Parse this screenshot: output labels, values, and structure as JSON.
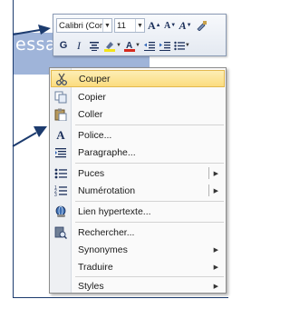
{
  "document": {
    "selected_text": "essai"
  },
  "mini_toolbar": {
    "font_name": "Calibri (Cor",
    "font_size": "11",
    "grow_font": "A",
    "shrink_font": "A",
    "styles": "A",
    "bold": "G",
    "italic": "I"
  },
  "context_menu": {
    "items": [
      {
        "label": "Couper",
        "icon": "scissors-icon"
      },
      {
        "label": "Copier",
        "icon": "copy-icon"
      },
      {
        "label": "Coller",
        "icon": "paste-icon"
      },
      {
        "label": "Police...",
        "icon": "font-icon"
      },
      {
        "label": "Paragraphe...",
        "icon": "paragraph-icon"
      },
      {
        "label": "Puces",
        "icon": "bullets-icon"
      },
      {
        "label": "Numérotation",
        "icon": "numbering-icon"
      },
      {
        "label": "Lien hypertexte...",
        "icon": "hyperlink-icon"
      },
      {
        "label": "Rechercher...",
        "icon": "research-icon"
      },
      {
        "label": "Synonymes"
      },
      {
        "label": "Traduire"
      },
      {
        "label": "Styles"
      }
    ]
  },
  "colors": {
    "selection": "#9fb4d9",
    "menu_hover": "#fbdc7f",
    "arrow": "#1c3b6e"
  }
}
